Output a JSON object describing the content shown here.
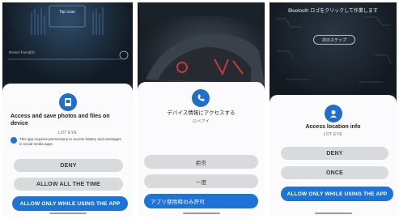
{
  "panel1": {
    "background": {
      "tap_label": "Tap scan",
      "device_label": "Device found(0)"
    },
    "icon": "photo-icon",
    "title": "Access and save photos and files on device",
    "app_name": "LOT EYE",
    "info_text": "This app requires permissions to access battery and messages in social media apps",
    "buttons": {
      "deny": "DENY",
      "allow_all": "ALLOW ALL THE TIME",
      "allow_while_using": "ALLOW ONLY WHILE USING THE APP"
    }
  },
  "panel2": {
    "icon": "phone-icon",
    "title": "デバイス情報にアクセスする",
    "app_name": "ロペアイ",
    "buttons": {
      "deny": "拒否",
      "once": "一度",
      "allow_while_using": "アプリ使用時のみ許可"
    }
  },
  "panel3": {
    "background": {
      "instruction": "Bluetooth ロゴをクリックして作業します",
      "next_step": "次のステップ"
    },
    "icon": "location-icon",
    "title": "Access location info",
    "app_name": "LOT EYE",
    "buttons": {
      "deny": "DENY",
      "once": "ONCE",
      "allow_while_using": "ALLOW ONLY WHILE USING THE APP"
    }
  },
  "colors": {
    "accent": "#1e74d6",
    "secondary_button": "#d9dadc",
    "sheet": "#fbfbfd"
  }
}
